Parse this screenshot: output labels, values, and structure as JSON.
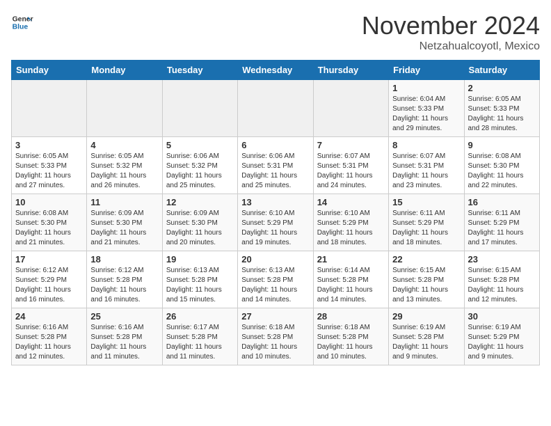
{
  "header": {
    "logo_line1": "General",
    "logo_line2": "Blue",
    "month": "November 2024",
    "location": "Netzahualcoyotl, Mexico"
  },
  "weekdays": [
    "Sunday",
    "Monday",
    "Tuesday",
    "Wednesday",
    "Thursday",
    "Friday",
    "Saturday"
  ],
  "weeks": [
    [
      {
        "day": "",
        "info": ""
      },
      {
        "day": "",
        "info": ""
      },
      {
        "day": "",
        "info": ""
      },
      {
        "day": "",
        "info": ""
      },
      {
        "day": "",
        "info": ""
      },
      {
        "day": "1",
        "info": "Sunrise: 6:04 AM\nSunset: 5:33 PM\nDaylight: 11 hours and 29 minutes."
      },
      {
        "day": "2",
        "info": "Sunrise: 6:05 AM\nSunset: 5:33 PM\nDaylight: 11 hours and 28 minutes."
      }
    ],
    [
      {
        "day": "3",
        "info": "Sunrise: 6:05 AM\nSunset: 5:33 PM\nDaylight: 11 hours and 27 minutes."
      },
      {
        "day": "4",
        "info": "Sunrise: 6:05 AM\nSunset: 5:32 PM\nDaylight: 11 hours and 26 minutes."
      },
      {
        "day": "5",
        "info": "Sunrise: 6:06 AM\nSunset: 5:32 PM\nDaylight: 11 hours and 25 minutes."
      },
      {
        "day": "6",
        "info": "Sunrise: 6:06 AM\nSunset: 5:31 PM\nDaylight: 11 hours and 25 minutes."
      },
      {
        "day": "7",
        "info": "Sunrise: 6:07 AM\nSunset: 5:31 PM\nDaylight: 11 hours and 24 minutes."
      },
      {
        "day": "8",
        "info": "Sunrise: 6:07 AM\nSunset: 5:31 PM\nDaylight: 11 hours and 23 minutes."
      },
      {
        "day": "9",
        "info": "Sunrise: 6:08 AM\nSunset: 5:30 PM\nDaylight: 11 hours and 22 minutes."
      }
    ],
    [
      {
        "day": "10",
        "info": "Sunrise: 6:08 AM\nSunset: 5:30 PM\nDaylight: 11 hours and 21 minutes."
      },
      {
        "day": "11",
        "info": "Sunrise: 6:09 AM\nSunset: 5:30 PM\nDaylight: 11 hours and 21 minutes."
      },
      {
        "day": "12",
        "info": "Sunrise: 6:09 AM\nSunset: 5:30 PM\nDaylight: 11 hours and 20 minutes."
      },
      {
        "day": "13",
        "info": "Sunrise: 6:10 AM\nSunset: 5:29 PM\nDaylight: 11 hours and 19 minutes."
      },
      {
        "day": "14",
        "info": "Sunrise: 6:10 AM\nSunset: 5:29 PM\nDaylight: 11 hours and 18 minutes."
      },
      {
        "day": "15",
        "info": "Sunrise: 6:11 AM\nSunset: 5:29 PM\nDaylight: 11 hours and 18 minutes."
      },
      {
        "day": "16",
        "info": "Sunrise: 6:11 AM\nSunset: 5:29 PM\nDaylight: 11 hours and 17 minutes."
      }
    ],
    [
      {
        "day": "17",
        "info": "Sunrise: 6:12 AM\nSunset: 5:29 PM\nDaylight: 11 hours and 16 minutes."
      },
      {
        "day": "18",
        "info": "Sunrise: 6:12 AM\nSunset: 5:28 PM\nDaylight: 11 hours and 16 minutes."
      },
      {
        "day": "19",
        "info": "Sunrise: 6:13 AM\nSunset: 5:28 PM\nDaylight: 11 hours and 15 minutes."
      },
      {
        "day": "20",
        "info": "Sunrise: 6:13 AM\nSunset: 5:28 PM\nDaylight: 11 hours and 14 minutes."
      },
      {
        "day": "21",
        "info": "Sunrise: 6:14 AM\nSunset: 5:28 PM\nDaylight: 11 hours and 14 minutes."
      },
      {
        "day": "22",
        "info": "Sunrise: 6:15 AM\nSunset: 5:28 PM\nDaylight: 11 hours and 13 minutes."
      },
      {
        "day": "23",
        "info": "Sunrise: 6:15 AM\nSunset: 5:28 PM\nDaylight: 11 hours and 12 minutes."
      }
    ],
    [
      {
        "day": "24",
        "info": "Sunrise: 6:16 AM\nSunset: 5:28 PM\nDaylight: 11 hours and 12 minutes."
      },
      {
        "day": "25",
        "info": "Sunrise: 6:16 AM\nSunset: 5:28 PM\nDaylight: 11 hours and 11 minutes."
      },
      {
        "day": "26",
        "info": "Sunrise: 6:17 AM\nSunset: 5:28 PM\nDaylight: 11 hours and 11 minutes."
      },
      {
        "day": "27",
        "info": "Sunrise: 6:18 AM\nSunset: 5:28 PM\nDaylight: 11 hours and 10 minutes."
      },
      {
        "day": "28",
        "info": "Sunrise: 6:18 AM\nSunset: 5:28 PM\nDaylight: 11 hours and 10 minutes."
      },
      {
        "day": "29",
        "info": "Sunrise: 6:19 AM\nSunset: 5:28 PM\nDaylight: 11 hours and 9 minutes."
      },
      {
        "day": "30",
        "info": "Sunrise: 6:19 AM\nSunset: 5:29 PM\nDaylight: 11 hours and 9 minutes."
      }
    ]
  ]
}
